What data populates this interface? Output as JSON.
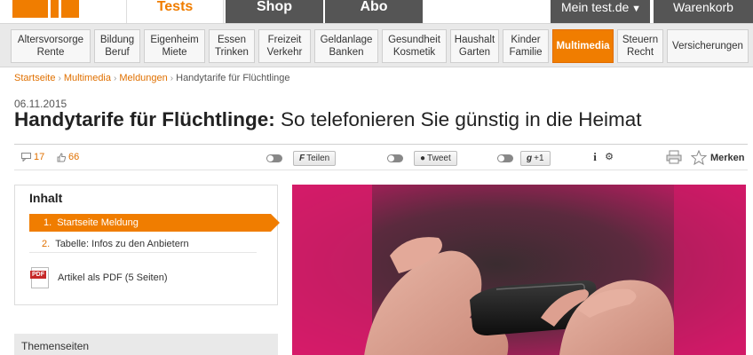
{
  "header": {
    "tabs": [
      {
        "label": "Tests",
        "active": true
      },
      {
        "label": "Shop",
        "active": false
      },
      {
        "label": "Abo",
        "active": false
      }
    ],
    "user_menu": {
      "label": "Mein test.de",
      "chevron": "chevron-down-icon"
    },
    "cart": {
      "label": "Warenkorb"
    }
  },
  "categories": [
    {
      "line1": "Altersvorsorge",
      "line2": "Rente"
    },
    {
      "line1": "Bildung",
      "line2": "Beruf"
    },
    {
      "line1": "Eigenheim",
      "line2": "Miete"
    },
    {
      "line1": "Essen",
      "line2": "Trinken"
    },
    {
      "line1": "Freizeit",
      "line2": "Verkehr"
    },
    {
      "line1": "Geldanlage",
      "line2": "Banken"
    },
    {
      "line1": "Gesundheit",
      "line2": "Kosmetik"
    },
    {
      "line1": "Haushalt",
      "line2": "Garten"
    },
    {
      "line1": "Kinder",
      "line2": "Familie"
    },
    {
      "line1": "Multimedia",
      "line2": "",
      "active": true
    },
    {
      "line1": "Steuern",
      "line2": "Recht"
    },
    {
      "line1": "Versicherungen",
      "line2": ""
    }
  ],
  "breadcrumb": [
    "Startseite",
    "Multimedia",
    "Meldungen",
    "Handytarife für Flüchtlinge"
  ],
  "article": {
    "date": "06.11.2015",
    "title_bold": "Handytarife für Flüchtlinge:",
    "title_rest": " So telefonieren Sie günstig in die Heimat"
  },
  "toolbar": {
    "comments_count": "17",
    "likes_count": "66",
    "facebook_label": "Teilen",
    "facebook_glyph": "F",
    "twitter_label": "Tweet",
    "gplus_label": "+1",
    "merken_label": "Merken",
    "info_glyph": "i",
    "gear_glyph": "⚙"
  },
  "contents": {
    "heading": "Inhalt",
    "items": [
      {
        "number": "1.",
        "label": "Startseite Meldung",
        "active": true
      },
      {
        "number": "2.",
        "label": "Tabelle: Infos zu den Anbietern",
        "active": false
      }
    ],
    "pdf_label": "Artikel als PDF (5 Seiten)"
  },
  "themen": {
    "label": "Themenseiten"
  },
  "colors": {
    "accent": "#f07d00",
    "dark_tab": "#555555",
    "hero_bg": "#d41c6c"
  }
}
